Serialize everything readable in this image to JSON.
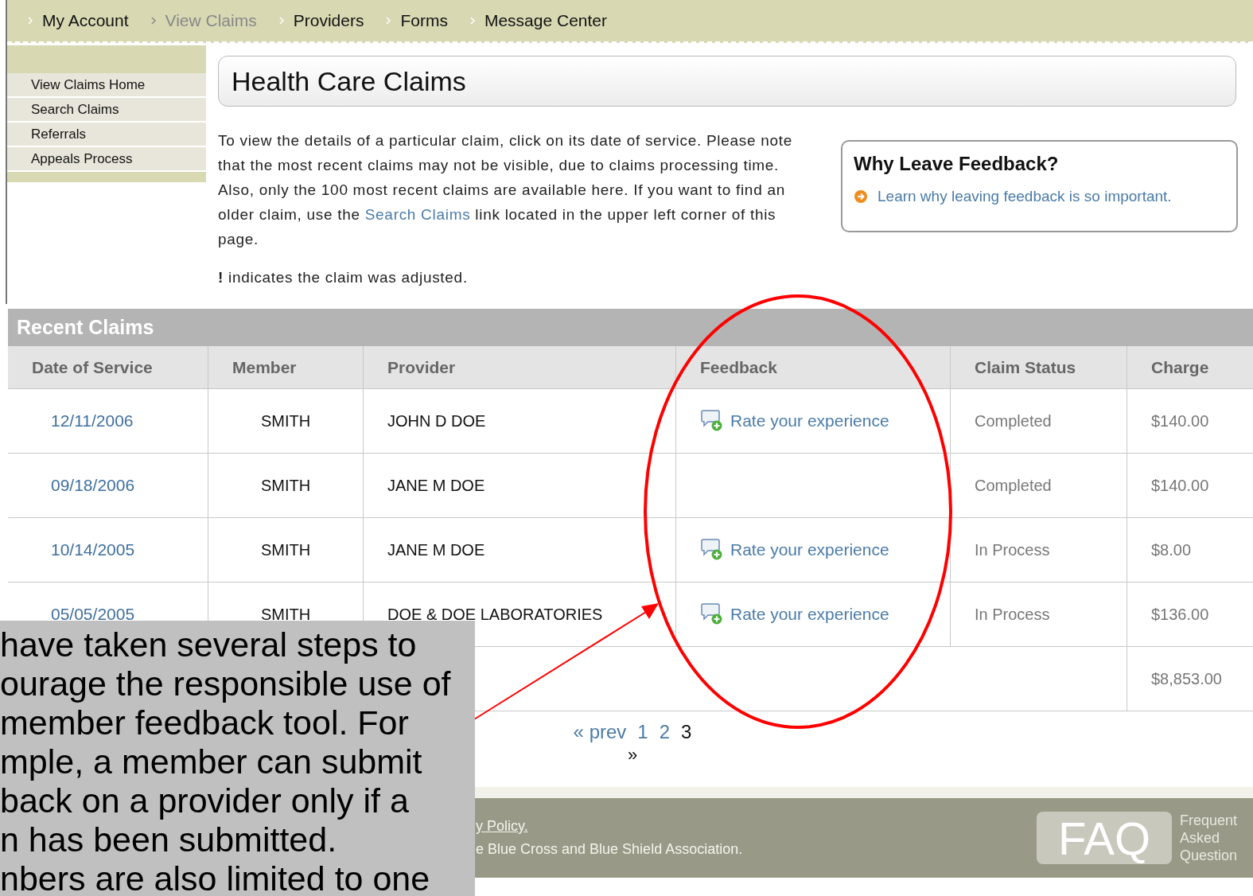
{
  "nav": [
    {
      "label": "My Account",
      "selected": false
    },
    {
      "label": "View Claims",
      "selected": true
    },
    {
      "label": "Providers",
      "selected": false
    },
    {
      "label": "Forms",
      "selected": false
    },
    {
      "label": "Message Center",
      "selected": false
    }
  ],
  "sidebar": {
    "items": [
      "View Claims Home",
      "Search Claims",
      "Referrals",
      "Appeals Process"
    ]
  },
  "page_title": "Health Care Claims",
  "intro": {
    "before": "To view the details of a particular claim, click on its date of service. Please note that the most recent claims may not be visible, due to claims processing time. Also, only the 100 most recent claims are available here. If you want to find an older claim, use the ",
    "link": "Search Claims",
    "after": " link located in the upper left corner of this page."
  },
  "legend": "**!** indicates the claim was adjusted.",
  "feedback_box": {
    "title": "Why Leave Feedback?",
    "link": "Learn why leaving feedback is so important."
  },
  "table": {
    "title": "Recent Claims",
    "columns": [
      "Date of Service",
      "Member",
      "Provider",
      "Feedback",
      "Claim Status",
      "Charge"
    ],
    "rows": [
      {
        "date": "12/11/2006",
        "member": "SMITH",
        "provider": "JOHN D DOE",
        "feedback": "Rate your experience",
        "status": "Completed",
        "charge": "$140.00"
      },
      {
        "date": "09/18/2006",
        "member": "SMITH",
        "provider": "JANE M DOE",
        "status": "Completed",
        "charge": "$140.00"
      },
      {
        "date": "10/14/2005",
        "member": "SMITH",
        "provider": "JANE M DOE",
        "feedback": "Rate your experience",
        "status": "In Process",
        "charge": "$8.00"
      },
      {
        "date": "05/05/2005",
        "member": "SMITH",
        "provider": "DOE & DOE LABORATORIES",
        "feedback": "Rate your experience",
        "status": "In Process",
        "charge": "$136.00"
      }
    ],
    "total": "$8,853.00"
  },
  "pagination": {
    "prev": "« prev",
    "pages": [
      {
        "label": "1",
        "selected": false
      },
      {
        "label": "2",
        "selected": false
      },
      {
        "label": "3",
        "selected": true
      }
    ],
    "next": "»"
  },
  "footer": {
    "link": "y Policy.",
    "text": "e Blue Cross and Blue Shield Association.",
    "faq_logo": "FAQ",
    "faq_caption": [
      "Frequent",
      "Asked",
      "Question"
    ]
  },
  "callout": {
    "lines": [
      "have taken several steps to",
      "ourage the responsible use of",
      "member feedback tool. For",
      "mple, a member can submit",
      "back on a provider only if a",
      "n has been submitted.",
      "nbers are also limited to one"
    ]
  }
}
